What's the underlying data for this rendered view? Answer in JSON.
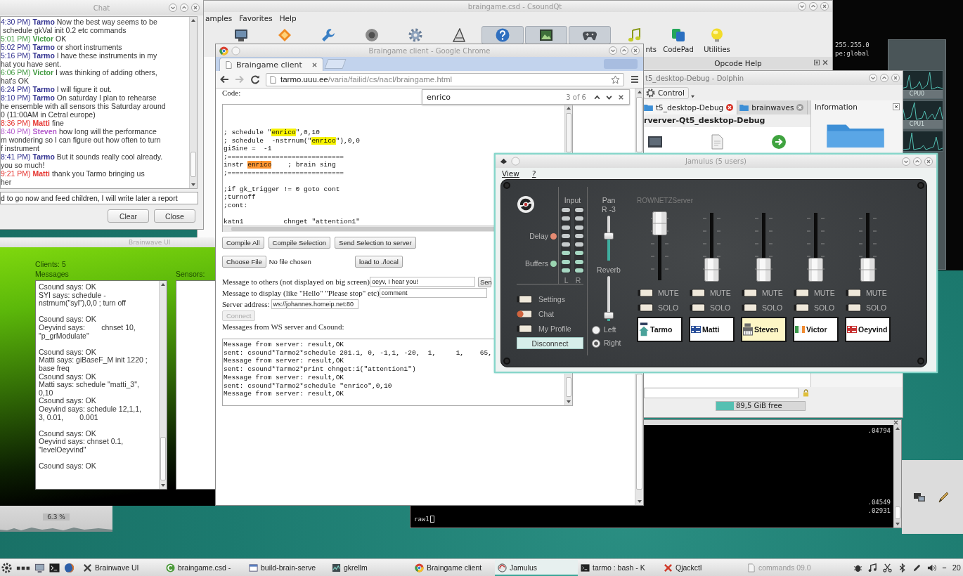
{
  "system_monitor": {
    "graphs": [
      {
        "label": "CPU0"
      },
      {
        "label": "CPU1"
      }
    ]
  },
  "terminal_top": {
    "lines": [
      "255.255.0",
      "pe:global"
    ]
  },
  "csoundqt": {
    "title": "braingame.csd - CsoundQt",
    "menu": [
      "amples",
      "Favorites",
      "Help"
    ],
    "toolbar": [
      {
        "kind": "monitor",
        "checked": false
      },
      {
        "kind": "diamond",
        "checked": false
      },
      {
        "kind": "key",
        "checked": false
      },
      {
        "kind": "record",
        "checked": false
      },
      {
        "kind": "gear",
        "checked": false
      },
      {
        "kind": "compass",
        "checked": false
      },
      {
        "kind": "help",
        "checked": true
      },
      {
        "kind": "image",
        "checked": true
      },
      {
        "kind": "gamepad",
        "checked": true
      },
      {
        "kind": "note",
        "checked": false,
        "label": "nts"
      },
      {
        "kind": "codepad",
        "checked": false,
        "label": "CodePad"
      },
      {
        "kind": "bulb",
        "checked": false,
        "label": "Utilities"
      }
    ],
    "dock_title": "Opcode Help"
  },
  "dolphin": {
    "title": "t5_desktop-Debug - Dolphin",
    "control": "Control",
    "tabs": [
      {
        "label": "t5_desktop-Debug",
        "selected": true
      },
      {
        "label": "brainwaves",
        "selected": false
      }
    ],
    "heading": "rverver-Qt5_desktop-Debug",
    "info_title": "Information",
    "free_space": {
      "label": "89,5 GiB free",
      "level": 0.2
    }
  },
  "terminal": {
    "values": [
      ".04794",
      ".04549",
      ".02931"
    ],
    "prompt": "raw1"
  },
  "load_monitor": {
    "reading": "6.3 %"
  },
  "chat": {
    "title": "Chat",
    "messages": [
      {
        "time": "4:30 PM)",
        "sender": "Tarmo",
        "color": "#2e2e8e",
        "lines": [
          "Now the best way seems to be",
          " schedule gkVal init 0.2 etc commands"
        ]
      },
      {
        "time": "5:01 PM)",
        "sender": "Victor",
        "color": "#3f993f",
        "lines": [
          "OK"
        ]
      },
      {
        "time": "5:02 PM)",
        "sender": "Tarmo",
        "color": "#2e2e8e",
        "lines": [
          "or short instruments"
        ]
      },
      {
        "time": "5:16 PM)",
        "sender": "Tarmo",
        "color": "#2e2e8e",
        "lines": [
          "I have these instruments in my",
          "hat you have sent."
        ]
      },
      {
        "time": "6:06 PM)",
        "sender": "Victor",
        "color": "#3f993f",
        "lines": [
          "I was thinking of adding others,",
          "hat's OK"
        ]
      },
      {
        "time": "6:24 PM)",
        "sender": "Tarmo",
        "color": "#2e2e8e",
        "lines": [
          "I will figure it out."
        ]
      },
      {
        "time": "8:10 PM)",
        "sender": "Tarmo",
        "color": "#2e2e8e",
        "lines": [
          "On saturday I plan to rehearse",
          "he ensemble with all sensors this Saturday around",
          "0 (11:00AM in Cetral europe)"
        ]
      },
      {
        "time": "8:36 PM)",
        "sender": "Matti",
        "color": "#e5332e",
        "lines": [
          "fine"
        ]
      },
      {
        "time": "8:40 PM)",
        "sender": "Steven",
        "color": "#b45ccc",
        "lines": [
          "how long will the performance",
          "m wondering so I can figure out how often to turn",
          "f instrument"
        ]
      },
      {
        "time": "8:41 PM)",
        "sender": "Tarmo",
        "color": "#2e2e8e",
        "lines": [
          "But it sounds really cool already.",
          "you so much!"
        ]
      },
      {
        "time": "9:21 PM)",
        "sender": "Matti",
        "color": "#e5332e",
        "lines": [
          "thank you Tarmo bringing us",
          "her"
        ]
      }
    ],
    "input_value": "d to go now and feed children, I will write later a report",
    "buttons": [
      "Clear",
      "Close"
    ]
  },
  "brainwave": {
    "title": "Brainwave UI",
    "clients": "Clients: 5",
    "messages_label": "Messages",
    "sensors_label": "Sensors:",
    "message_groups": [
      {
        "messages": [
          {
            "lines": [
              "Csound says: OK"
            ]
          },
          {
            "lines": [
              "SYI says: schedule -",
              "nstrnum(\"syl\"),0,0 ; turn off"
            ]
          }
        ]
      },
      {
        "messages": [
          {
            "lines": [
              "Csound says: OK"
            ]
          },
          {
            "lines": [
              "Oeyvind says:        chnset 10,",
              "\"p_grModulate\""
            ]
          }
        ]
      },
      {
        "messages": [
          {
            "lines": [
              "Csound says: OK"
            ]
          },
          {
            "lines": [
              "Matti says: giBaseF_M init 1220 ;",
              "base freq"
            ]
          },
          {
            "lines": [
              "Csound says: OK"
            ]
          },
          {
            "lines": [
              "Matti says: schedule \"matti_3\",",
              "0,10"
            ]
          },
          {
            "lines": [
              "Csound says: OK"
            ]
          },
          {
            "lines": [
              "Oeyvind says: schedule 12,1,1,",
              "3, 0.01,        0.001"
            ]
          }
        ]
      },
      {
        "messages": [
          {
            "lines": [
              "Csound says: OK"
            ]
          },
          {
            "lines": [
              "Oeyvind says: chnset 0.1,",
              "\"levelOeyvind\""
            ]
          }
        ]
      },
      {
        "messages": [
          {
            "lines": [
              "Csound says: OK"
            ]
          }
        ]
      }
    ]
  },
  "chrome": {
    "title": "Braingame client - Google Chrome",
    "tab": "Braingame client",
    "url": {
      "host": "tarmo.uuu.ee",
      "path": "/varia/failid/cs/nacl/braingame.html"
    },
    "code_label": "Code:",
    "find": {
      "query": "enrico",
      "count": "3 of 6"
    },
    "code_blocks": [
      {
        "lines": [
          {
            "segments": [
              {
                "text": "; schedule \"",
                "kind": "plain"
              },
              {
                "text": "enrico",
                "kind": "match"
              },
              {
                "text": "\",0,10",
                "kind": "plain"
              }
            ]
          },
          {
            "segments": [
              {
                "text": "; schedule  -nstrnum(\"",
                "kind": "plain"
              },
              {
                "text": "enrico",
                "kind": "match"
              },
              {
                "text": "\"),0,0",
                "kind": "plain"
              }
            ]
          },
          {
            "segments": [
              {
                "text": "giSine =  -1",
                "kind": "plain"
              }
            ]
          },
          {
            "segments": [
              {
                "text": ";=============================",
                "kind": "plain"
              }
            ]
          },
          {
            "segments": [
              {
                "text": "instr ",
                "kind": "plain"
              },
              {
                "text": "enrico",
                "kind": "current"
              },
              {
                "text": "    ; brain sing",
                "kind": "plain"
              }
            ]
          },
          {
            "segments": [
              {
                "text": ";=============================",
                "kind": "plain"
              }
            ]
          }
        ]
      },
      {
        "lines": [
          {
            "segments": [
              {
                "text": ";if gk_trigger != 0 goto cont",
                "kind": "plain"
              }
            ]
          },
          {
            "segments": [
              {
                "text": ";turnoff",
                "kind": "plain"
              }
            ]
          },
          {
            "segments": [
              {
                "text": ";cont:",
                "kind": "plain"
              }
            ]
          }
        ]
      },
      {
        "lines": [
          {
            "segments": [
              {
                "text": "katn1          chnget \"attention1\"",
                "kind": "plain"
              }
            ]
          }
        ]
      }
    ],
    "buttons": [
      "Compile All",
      "Compile Selection",
      "Send Selection to server"
    ],
    "file_button": "Choose File",
    "file_status": "No file chosen",
    "load_button": "load to ./local",
    "fields": [
      {
        "label": "Message to others (not displayed on big screen)",
        "value": "oeyv, I hear you!",
        "button": "Sen"
      },
      {
        "label": "Message to display (like \"Hello\" \"Please stop\" etc)",
        "value": "comment"
      },
      {
        "label": "Server address:",
        "value": "ws://johannes.homeip.net:80"
      }
    ],
    "connect": {
      "label": "Connect",
      "disabled": true
    },
    "log_label": "Messages from WS server and Csound:",
    "log": [
      "Message from server: result,OK",
      "sent: csound*Tarmo2*schedule 201.1, 0, -1,1, -20,  1,     1,    65,",
      "Message from server: result,OK",
      "sent: csound*Tarmo2*print chnget:i(\"attention1\")",
      "Message from server: result,OK",
      "sent: csound*Tarmo2*schedule \"enrico\",0,10",
      "Message from server: result,OK"
    ]
  },
  "jamulus": {
    "title": "Jamulus (5 users)",
    "menu": [
      "View",
      "?"
    ],
    "status_lights": [
      {
        "label": "Delay",
        "color": "#e58a72"
      },
      {
        "label": "Buffers",
        "color": "#9ad4b0"
      }
    ],
    "input_label": "Input",
    "meters": [
      {
        "label": "L",
        "level": 0.375
      },
      {
        "label": "R",
        "level": 0.375
      }
    ],
    "toggles": [
      {
        "label": "Settings",
        "on": false
      },
      {
        "label": "Chat",
        "on": true
      },
      {
        "label": "My Profile",
        "on": false
      }
    ],
    "disconnect": "Disconnect",
    "pan": {
      "label": "Pan",
      "reading": "R -3",
      "level": 0.55
    },
    "reverb": {
      "label": "Reverb",
      "level": 0.05
    },
    "reverb_channel": [
      {
        "label": "Left",
        "selected": false
      },
      {
        "label": "Right",
        "selected": true
      }
    ],
    "server": "ROWNETZServer",
    "channels": [
      {
        "name": "Tarmo",
        "kind": "house",
        "color": "#4aa29a",
        "level": 1,
        "mute": {
          "label": "MUTE",
          "on": false
        },
        "solo": {
          "label": "SOLO",
          "on": false
        },
        "highlighted": false
      },
      {
        "name": "Matti",
        "kind": "cross-flag",
        "color": "#2a4f9a",
        "level": 0,
        "mute": {
          "label": "MUTE",
          "on": false
        },
        "solo": {
          "label": "SOLO",
          "on": false
        },
        "highlighted": false
      },
      {
        "name": "Steven",
        "kind": "keyboard",
        "color": "#6a6a6a",
        "level": 0,
        "mute": {
          "label": "MUTE",
          "on": false
        },
        "solo": {
          "label": "SOLO",
          "on": false
        },
        "highlighted": true
      },
      {
        "name": "Victor",
        "kind": "tricolor",
        "color": "#3a9a4a",
        "level": 0,
        "mute": {
          "label": "MUTE",
          "on": false
        },
        "solo": {
          "label": "SOLO",
          "on": false
        },
        "highlighted": false
      },
      {
        "name": "Oeyvind",
        "kind": "cross-flag",
        "color": "#c83030",
        "level": 0,
        "mute": {
          "label": "MUTE",
          "on": false
        },
        "solo": {
          "label": "SOLO",
          "on": false
        },
        "highlighted": false
      }
    ]
  },
  "taskbar": {
    "tasks": [
      {
        "label": "Brainwave UI",
        "kind": "app",
        "active": false,
        "minimized": false
      },
      {
        "label": "braingame.csd -",
        "kind": "editor",
        "active": false,
        "minimized": false
      },
      {
        "label": "build-brain-serve",
        "kind": "folder",
        "active": false,
        "minimized": false
      },
      {
        "label": "gkrellm",
        "kind": "monitor",
        "active": false,
        "minimized": false
      },
      {
        "label": "Braingame client",
        "kind": "browser",
        "active": false,
        "minimized": false
      },
      {
        "label": "Jamulus",
        "kind": "audio",
        "active": true,
        "minimized": false
      },
      {
        "label": "tarmo : bash - K",
        "kind": "terminal",
        "active": false,
        "minimized": false
      },
      {
        "label": "Qjackctl",
        "kind": "jack",
        "active": false,
        "minimized": false
      },
      {
        "label": "commands 09.0",
        "kind": "document",
        "active": false,
        "minimized": true
      }
    ],
    "clock": "20"
  }
}
